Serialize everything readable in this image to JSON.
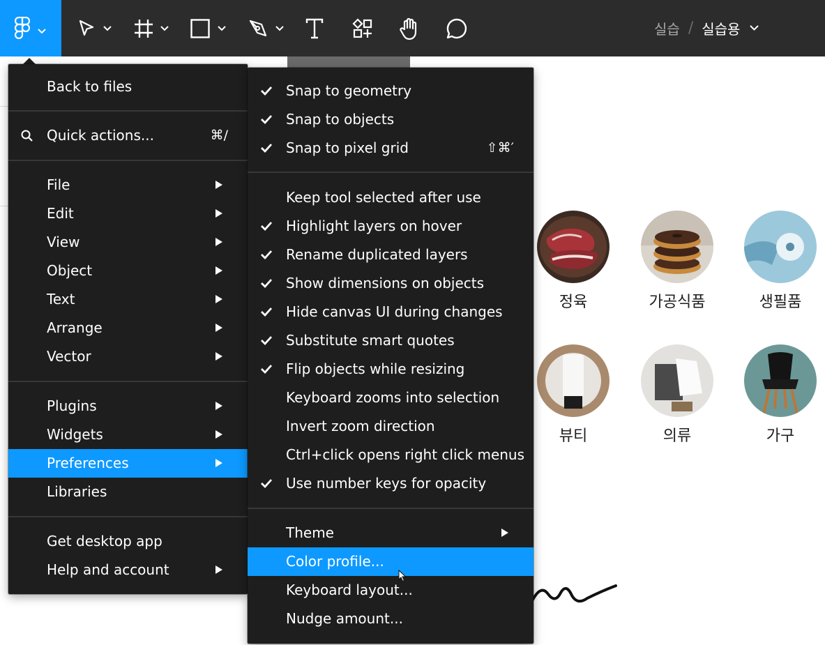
{
  "toolbar": {
    "tools": [
      {
        "icon": "figma-logo-icon"
      },
      {
        "icon": "move-tool-icon"
      },
      {
        "icon": "frame-tool-icon"
      },
      {
        "icon": "rectangle-tool-icon"
      },
      {
        "icon": "pen-tool-icon"
      },
      {
        "icon": "text-tool-icon"
      },
      {
        "icon": "resources-icon"
      },
      {
        "icon": "hand-tool-icon"
      },
      {
        "icon": "comment-icon"
      }
    ],
    "breadcrumb": {
      "project": "실습",
      "separator": "/",
      "file": "실습용"
    },
    "accent_color": "#0d99ff",
    "bg_color": "#2c2c2c"
  },
  "main_menu": {
    "items": [
      {
        "label": "Back to files"
      },
      {
        "label": "Quick actions...",
        "shortcut": "⌘/"
      },
      {
        "label": "File"
      },
      {
        "label": "Edit"
      },
      {
        "label": "View"
      },
      {
        "label": "Object"
      },
      {
        "label": "Text"
      },
      {
        "label": "Arrange"
      },
      {
        "label": "Vector"
      },
      {
        "label": "Plugins"
      },
      {
        "label": "Widgets"
      },
      {
        "label": "Preferences",
        "active": true
      },
      {
        "label": "Libraries"
      },
      {
        "label": "Get desktop app"
      },
      {
        "label": "Help and account"
      }
    ]
  },
  "preferences_menu": {
    "items": [
      {
        "label": "Snap to geometry",
        "checked": true
      },
      {
        "label": "Snap to objects",
        "checked": true
      },
      {
        "label": "Snap to pixel grid",
        "checked": true,
        "shortcut": "⇧⌘′"
      },
      {
        "label": "Keep tool selected after use",
        "checked": false
      },
      {
        "label": "Highlight layers on hover",
        "checked": true
      },
      {
        "label": "Rename duplicated layers",
        "checked": true
      },
      {
        "label": "Show dimensions on objects",
        "checked": true
      },
      {
        "label": "Hide canvas UI during changes",
        "checked": true
      },
      {
        "label": "Substitute smart quotes",
        "checked": true
      },
      {
        "label": "Flip objects while resizing",
        "checked": true
      },
      {
        "label": "Keyboard zooms into selection",
        "checked": false
      },
      {
        "label": "Invert zoom direction",
        "checked": false
      },
      {
        "label": "Ctrl+click opens right click menus",
        "checked": false
      },
      {
        "label": "Use number keys for opacity",
        "checked": true
      },
      {
        "label": "Theme"
      },
      {
        "label": "Color profile...",
        "active": true
      },
      {
        "label": "Keyboard layout..."
      },
      {
        "label": "Nudge amount..."
      }
    ]
  },
  "canvas": {
    "categories": [
      {
        "label": "정육"
      },
      {
        "label": "가공식품"
      },
      {
        "label": "생필품"
      },
      {
        "label": "뷰티"
      },
      {
        "label": "의류"
      },
      {
        "label": "가구"
      }
    ]
  }
}
